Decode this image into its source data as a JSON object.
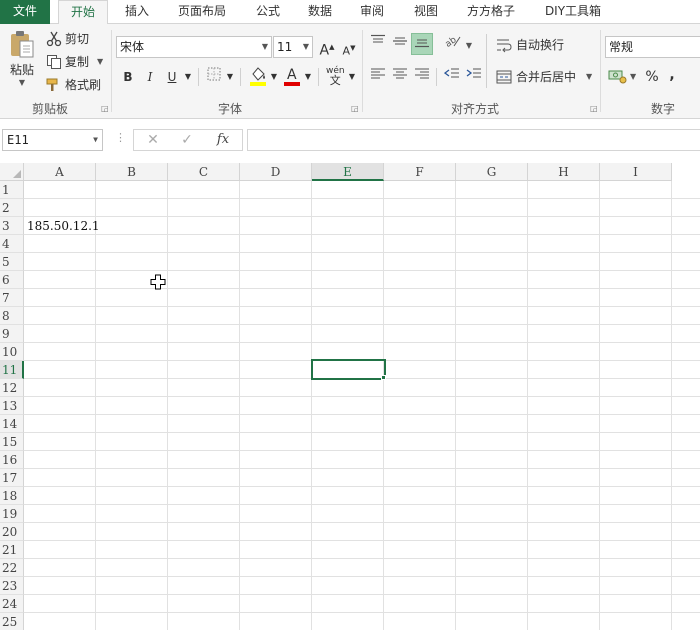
{
  "tabs": [
    {
      "label": "文件"
    },
    {
      "label": "开始"
    },
    {
      "label": "插入"
    },
    {
      "label": "页面布局"
    },
    {
      "label": "公式"
    },
    {
      "label": "数据"
    },
    {
      "label": "审阅"
    },
    {
      "label": "视图"
    },
    {
      "label": "方方格子"
    },
    {
      "label": "DIY工具箱"
    }
  ],
  "clipboard": {
    "paste_label": "粘贴",
    "cut_label": "剪切",
    "copy_label": "复制",
    "format_painter_label": "格式刷",
    "group_label": "剪贴板"
  },
  "font": {
    "name": "宋体",
    "size": "11",
    "bold": "B",
    "italic": "I",
    "underline": "U",
    "grow": "A",
    "shrink": "A",
    "color_letter": "A",
    "phonetic": "wén",
    "phonetic_char": "文",
    "group_label": "字体",
    "fill_color": "#ffff00",
    "font_color": "#e00000"
  },
  "alignment": {
    "wrap_label": "自动换行",
    "merge_label": "合并后居中",
    "group_label": "对齐方式"
  },
  "number": {
    "format": "常规",
    "percent": "%",
    "comma": ",",
    "group_label": "数字"
  },
  "formula_bar": {
    "name_box": "E11",
    "fx": "fx",
    "cancel": "✕",
    "enter": "✓",
    "content": ""
  },
  "sheet": {
    "columns": [
      "A",
      "B",
      "C",
      "D",
      "E",
      "F",
      "G",
      "H",
      "I"
    ],
    "rows": [
      "1",
      "2",
      "3",
      "4",
      "5",
      "6",
      "7",
      "8",
      "9",
      "10",
      "11",
      "12",
      "13",
      "14",
      "15",
      "16",
      "17",
      "18",
      "19",
      "20",
      "21",
      "22",
      "23",
      "24",
      "25"
    ],
    "selected_column": "E",
    "selected_row": "11",
    "cells": {
      "A3": "185.50.12.1"
    }
  },
  "colors": {
    "accent": "#217346"
  }
}
